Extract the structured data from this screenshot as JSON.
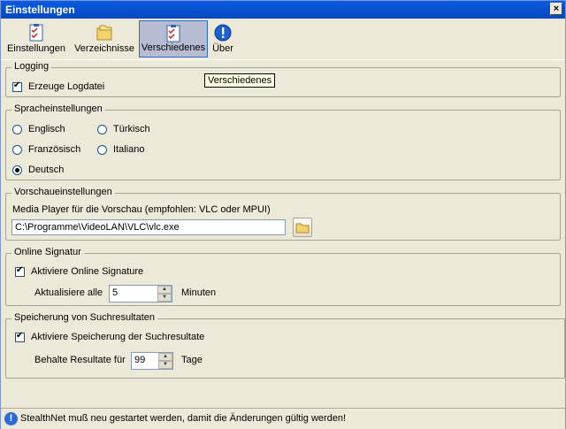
{
  "window": {
    "title": "Einstellungen",
    "close_glyph": "×"
  },
  "toolbar": {
    "items": [
      {
        "label": "Einstellungen",
        "icon": "checklist-icon"
      },
      {
        "label": "Verzeichnisse",
        "icon": "folders-icon"
      },
      {
        "label": "Verschiedenes",
        "icon": "checklist-icon",
        "active": true
      },
      {
        "label": "Über",
        "icon": "info-icon"
      }
    ]
  },
  "tooltip": "Verschiedenes",
  "logging": {
    "legend": "Logging",
    "create_log_label": "Erzeuge Logdatei",
    "create_log_checked": true
  },
  "language": {
    "legend": "Spracheinstellungen",
    "options": [
      {
        "label": "Englisch",
        "checked": false
      },
      {
        "label": "Türkisch",
        "checked": false
      },
      {
        "label": "Französisch",
        "checked": false
      },
      {
        "label": "Italiano",
        "checked": false
      },
      {
        "label": "Deutsch",
        "checked": true
      }
    ]
  },
  "preview": {
    "legend": "Vorschaueinstellungen",
    "player_label": "Media Player für die Vorschau (empfohlen: VLC oder MPUI)",
    "player_path": "C:\\Programme\\VideoLAN\\VLC\\vlc.exe"
  },
  "online_signature": {
    "legend": "Online Signatur",
    "activate_label": "Aktiviere Online Signature",
    "activate_checked": true,
    "refresh_label": "Aktualisiere alle",
    "refresh_value": "5",
    "refresh_unit": "Minuten"
  },
  "search_results": {
    "legend": "Speicherung von Suchresultaten",
    "activate_label": "Aktiviere Speicherung der Suchresultate",
    "activate_checked": true,
    "keep_label": "Behalte Resultate für",
    "keep_value": "99",
    "keep_unit": "Tage"
  },
  "status": {
    "message": "StealthNet muß neu gestartet werden, damit die Änderungen gültig werden!"
  },
  "colors": {
    "titlebar": "#0A5ADF",
    "face": "#ECE9D8",
    "tooltip": "#FFFFE1"
  }
}
